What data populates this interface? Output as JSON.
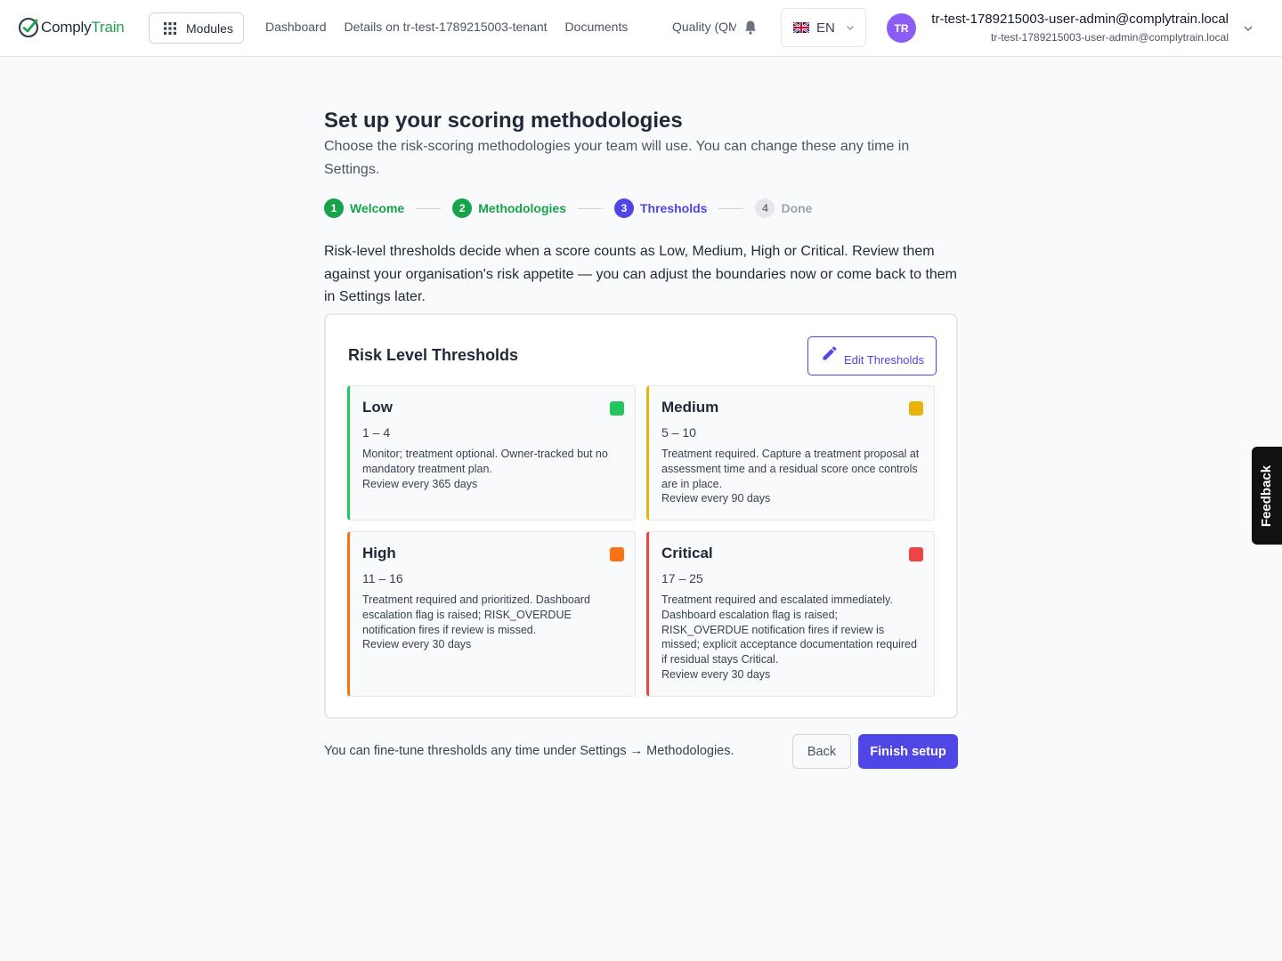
{
  "header": {
    "logo_part1": "Comply",
    "logo_part2": "Train",
    "modules_label": "Modules",
    "nav": [
      "Dashboard",
      "Details on tr-test-1789215003-tenant",
      "Documents",
      "Quality (QMS)"
    ],
    "language": "EN",
    "avatar_initials": "TR",
    "user_name": "tr-test-1789215003-user-admin@complytrain.local",
    "user_email": "tr-test-1789215003-user-admin@complytrain.local"
  },
  "page": {
    "title": "Set up your scoring methodologies",
    "subtitle": "Choose the risk-scoring methodologies your team will use. You can change these any time in Settings.",
    "steps": [
      {
        "num": "1",
        "label": "Welcome",
        "state": "done"
      },
      {
        "num": "2",
        "label": "Methodologies",
        "state": "done"
      },
      {
        "num": "3",
        "label": "Thresholds",
        "state": "active"
      },
      {
        "num": "4",
        "label": "Done",
        "state": "todo"
      }
    ],
    "intro": "Risk-level thresholds decide when a score counts as Low, Medium, High or Critical. Review them against your organisation's risk appetite — you can adjust the boundaries now or come back to them in Settings later."
  },
  "thresholds": {
    "title": "Risk Level Thresholds",
    "edit_label": "Edit Thresholds",
    "levels": [
      {
        "name": "Low",
        "range": "1 – 4",
        "color": "#22c55e",
        "description": "Monitor; treatment optional. Owner-tracked but no mandatory treatment plan.",
        "review": "Review every 365 days"
      },
      {
        "name": "Medium",
        "range": "5 – 10",
        "color": "#eab308",
        "description": "Treatment required. Capture a treatment proposal at assessment time and a residual score once controls are in place.",
        "review": "Review every 90 days"
      },
      {
        "name": "High",
        "range": "11 – 16",
        "color": "#f97316",
        "description": "Treatment required and prioritized. Dashboard escalation flag is raised; RISK_OVERDUE notification fires if review is missed.",
        "review": "Review every 30 days"
      },
      {
        "name": "Critical",
        "range": "17 – 25",
        "color": "#ef4444",
        "description": "Treatment required and escalated immediately. Dashboard escalation flag is raised; RISK_OVERDUE notification fires if review is missed; explicit acceptance documentation required if residual stays Critical.",
        "review": "Review every 30 days"
      }
    ]
  },
  "footer": {
    "note": "You can fine-tune thresholds any time under Settings → Methodologies.",
    "back_label": "Back",
    "finish_label": "Finish setup"
  },
  "feedback_label": "Feedback"
}
